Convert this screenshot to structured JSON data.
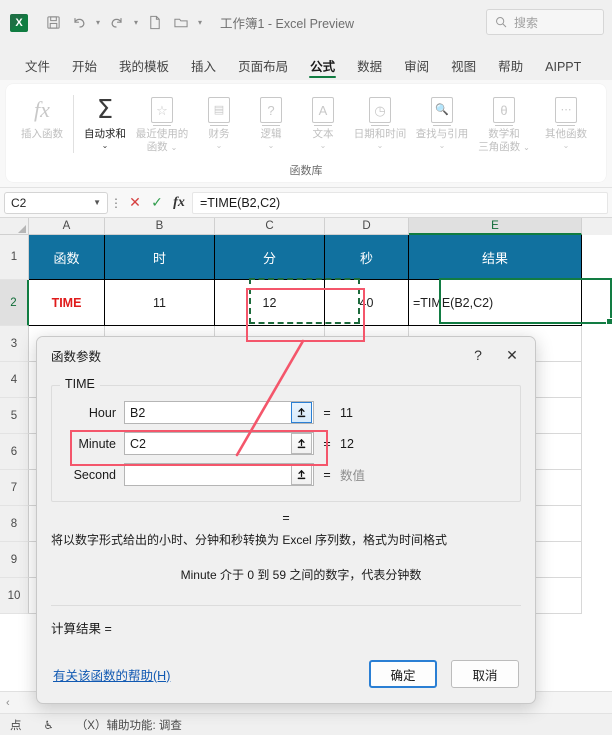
{
  "titlebar": {
    "logo_text": "X",
    "document_title": "工作簿1  -  Excel Preview",
    "quick_access": [
      {
        "name": "save-icon",
        "label": "保存"
      },
      {
        "name": "undo-icon",
        "label": "撤消"
      },
      {
        "name": "redo-icon",
        "label": "恢复"
      },
      {
        "name": "new-file-icon",
        "label": "新建"
      },
      {
        "name": "open-folder-icon",
        "label": "打开"
      },
      {
        "name": "customize-qat-icon",
        "label": "自定义快速访问工具栏"
      }
    ],
    "search": {
      "placeholder": "搜索",
      "icon": "search-icon"
    }
  },
  "ribbon": {
    "tabs": [
      {
        "label": "文件",
        "active": false
      },
      {
        "label": "开始",
        "active": false
      },
      {
        "label": "我的模板",
        "active": false
      },
      {
        "label": "插入",
        "active": false
      },
      {
        "label": "页面布局",
        "active": false
      },
      {
        "label": "公式",
        "active": true
      },
      {
        "label": "数据",
        "active": false
      },
      {
        "label": "审阅",
        "active": false
      },
      {
        "label": "视图",
        "active": false
      },
      {
        "label": "帮助",
        "active": false
      },
      {
        "label": "AIPPT",
        "active": false
      }
    ],
    "group_name": "函数库",
    "buttons": [
      {
        "label": "插入函数",
        "icon": "fx-icon",
        "glyph": "fx",
        "enabled": false,
        "caret": false
      },
      {
        "label": "自动求和",
        "icon": "autosum-sigma-icon",
        "glyph": "Σ",
        "enabled": true,
        "caret": true
      },
      {
        "label": "最近使用的\n函数",
        "icon": "recent-functions-icon",
        "glyph": "☆",
        "enabled": false,
        "caret": true
      },
      {
        "label": "财务",
        "icon": "financial-icon",
        "glyph": "▤",
        "enabled": false,
        "caret": true
      },
      {
        "label": "逻辑",
        "icon": "logical-icon",
        "glyph": "?",
        "enabled": false,
        "caret": true
      },
      {
        "label": "文本",
        "icon": "text-icon",
        "glyph": "A",
        "enabled": false,
        "caret": true
      },
      {
        "label": "日期和时间",
        "icon": "date-time-icon",
        "glyph": "◷",
        "enabled": false,
        "caret": true
      },
      {
        "label": "查找与引用",
        "icon": "lookup-reference-icon",
        "glyph": "◌",
        "enabled": false,
        "caret": true
      },
      {
        "label": "数学和\n三角函数",
        "icon": "math-trig-icon",
        "glyph": "θ",
        "enabled": false,
        "caret": true
      },
      {
        "label": "其他函数",
        "icon": "more-functions-icon",
        "glyph": "⋯",
        "enabled": false,
        "caret": true
      }
    ]
  },
  "formula_bar": {
    "name_box_value": "C2",
    "cancel_icon": "cancel-x-icon",
    "confirm_icon": "confirm-check-icon",
    "fx_icon": "insert-function-icon",
    "formula": "=TIME(B2,C2)"
  },
  "grid": {
    "column_headers": [
      "A",
      "B",
      "C",
      "D",
      "E"
    ],
    "selected_column": "E",
    "row_headers": [
      "1",
      "2",
      "3",
      "4",
      "5",
      "6",
      "7",
      "8",
      "9",
      "10"
    ],
    "selected_row": "2",
    "header_fill": "#11719f",
    "rows": [
      {
        "row": "1",
        "cells": [
          "函数",
          "时",
          "分",
          "秒",
          "结果"
        ],
        "style": "header"
      },
      {
        "row": "2",
        "cells": [
          "TIME",
          "11",
          "12",
          "40",
          "=TIME(B2,C2)"
        ],
        "style": "data"
      }
    ],
    "active_cell": "E2",
    "marching_ants_cell": "C2"
  },
  "dialog": {
    "title": "函数参数",
    "help_icon": "question-mark-icon",
    "close_icon": "close-x-icon",
    "function_name": "TIME",
    "arguments": [
      {
        "label": "Hour",
        "value": "B2",
        "result": "11",
        "result_muted": false,
        "focused": true,
        "collapse_icon": "collapse-dialog-icon"
      },
      {
        "label": "Minute",
        "value": "C2",
        "result": "12",
        "result_muted": false,
        "focused": false,
        "collapse_icon": "collapse-dialog-icon"
      },
      {
        "label": "Second",
        "value": "",
        "result": "数值",
        "result_muted": true,
        "focused": false,
        "collapse_icon": "collapse-dialog-icon"
      }
    ],
    "equals_sign": "=",
    "description": "将以数字形式给出的小时、分钟和秒转换为 Excel 序列数，格式为时间格式",
    "arg_help": "Minute  介于 0 到 59 之间的数字，代表分钟数",
    "calc_result_label": "计算结果 =",
    "calc_result_value": "",
    "help_link": "有关该函数的帮助(H)",
    "ok_button": "确定",
    "cancel_button": "取消"
  },
  "annotations": {
    "accent_color": "#f4566b",
    "highlight_cell": "C2",
    "highlight_field": "Minute",
    "arrow": "minute-field-to-cell-c2"
  },
  "status_bar": {
    "mode": "点",
    "accessibility_icon": "accessibility-icon",
    "accessibility_text": "（X）辅助功能: 调查"
  },
  "sheet_bar": {
    "nav_prev_icon": "sheet-nav-prev-icon"
  }
}
